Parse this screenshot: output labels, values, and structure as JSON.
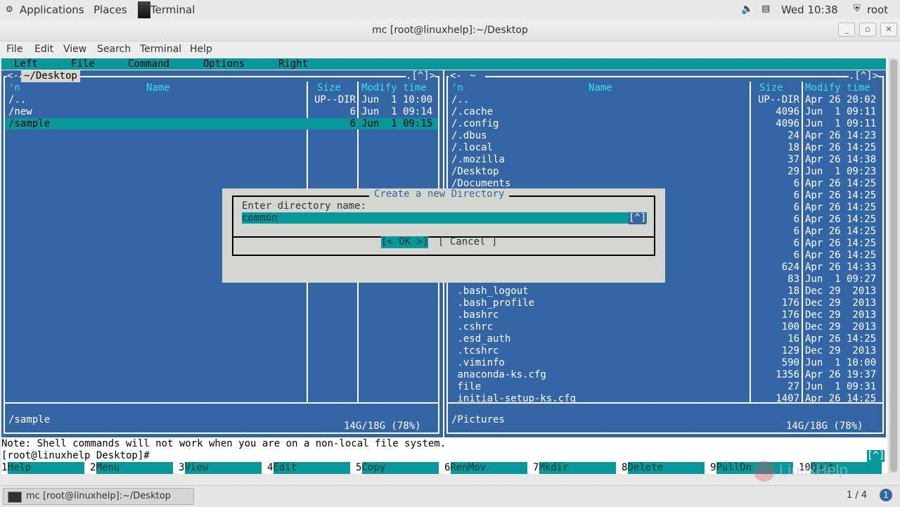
{
  "topbar": {
    "applications": "Applications",
    "places": "Places",
    "terminal": "Terminal",
    "volume_icon": "speaker-icon",
    "clock": "Wed 10:38",
    "user": "root"
  },
  "window": {
    "title": "mc [root@linuxhelp]:~/Desktop"
  },
  "menubar": {
    "items": [
      "File",
      "Edit",
      "View",
      "Search",
      "Terminal",
      "Help"
    ]
  },
  "mc": {
    "menu": [
      "Left",
      "File",
      "Command",
      "Options",
      "Right"
    ],
    "left": {
      "path": "~/Desktop",
      "corner": ".[^]>",
      "head": {
        "name": "Name",
        "size": "Size",
        "mtime": "Modify time",
        "sort": "'n"
      },
      "rows": [
        {
          "name": "/..",
          "size": "UP--DIR",
          "mtime": "Jun  1 10:00"
        },
        {
          "name": "/new",
          "size": "6",
          "mtime": "Jun  1 09:14"
        },
        {
          "name": "/sample",
          "size": "6",
          "mtime": "Jun  1 09:15"
        }
      ],
      "status": "/sample",
      "free": "14G/18G (78%)"
    },
    "right": {
      "path": "~",
      "corner": ".[^]>",
      "head": {
        "name": "Name",
        "size": "Size",
        "mtime": "Modify time",
        "sort": "'n"
      },
      "rows": [
        {
          "name": "/..",
          "size": "UP--DIR",
          "mtime": "Apr 26 20:02"
        },
        {
          "name": "/.cache",
          "size": "4096",
          "mtime": "Jun  1 09:11"
        },
        {
          "name": "/.config",
          "size": "4096",
          "mtime": "Jun  1 09:11"
        },
        {
          "name": "/.dbus",
          "size": "24",
          "mtime": "Apr 26 14:23"
        },
        {
          "name": "/.local",
          "size": "18",
          "mtime": "Apr 26 14:25"
        },
        {
          "name": "/.mozilla",
          "size": "37",
          "mtime": "Apr 26 14:38"
        },
        {
          "name": "/Desktop",
          "size": "29",
          "mtime": "Jun  1 09:23"
        },
        {
          "name": "/Documents",
          "size": "6",
          "mtime": "Apr 26 14:25"
        },
        {
          "name": "",
          "size": "6",
          "mtime": "Apr 26 14:25"
        },
        {
          "name": "",
          "size": "6",
          "mtime": "Apr 26 14:25"
        },
        {
          "name": "",
          "size": "6",
          "mtime": "Apr 26 14:25"
        },
        {
          "name": "",
          "size": "6",
          "mtime": "Apr 26 14:25"
        },
        {
          "name": "",
          "size": "6",
          "mtime": "Apr 26 14:25"
        },
        {
          "name": "",
          "size": "6",
          "mtime": "Apr 26 14:25"
        },
        {
          "name": "",
          "size": "624",
          "mtime": "Apr 26 14:33"
        },
        {
          "name": "",
          "size": "83",
          "mtime": "Jun  1 09:27"
        },
        {
          "name": " .bash_logout",
          "size": "18",
          "mtime": "Dec 29  2013"
        },
        {
          "name": " .bash_profile",
          "size": "176",
          "mtime": "Dec 29  2013"
        },
        {
          "name": " .bashrc",
          "size": "176",
          "mtime": "Dec 29  2013"
        },
        {
          "name": " .cshrc",
          "size": "100",
          "mtime": "Dec 29  2013"
        },
        {
          "name": " .esd_auth",
          "size": "16",
          "mtime": "Apr 26 14:25"
        },
        {
          "name": " .tcshrc",
          "size": "129",
          "mtime": "Dec 29  2013"
        },
        {
          "name": " .viminfo",
          "size": "590",
          "mtime": "Jun  1 10:00"
        },
        {
          "name": " anaconda-ks.cfg",
          "size": "1356",
          "mtime": "Apr 26 19:37"
        },
        {
          "name": " file",
          "size": "27",
          "mtime": "Jun  1 09:31"
        },
        {
          "name": " initial-setup-ks.cfg",
          "size": "1407",
          "mtime": "Apr 26 14:25"
        }
      ],
      "status": "/Pictures",
      "free": "14G/18G (78%)"
    },
    "dialog": {
      "title": "Create a new Directory",
      "prompt": "Enter directory name:",
      "value": "common",
      "history": "[^]",
      "ok": "[< OK >]",
      "cancel": "[ Cancel ]"
    },
    "note": "Note: Shell commands will not work when you are on a non-local file system.",
    "prompt": "[root@linuxhelp Desktop]#",
    "prompt_corner": "[^]",
    "fkeys": [
      {
        "n": "1",
        "l": "Help"
      },
      {
        "n": "2",
        "l": "Menu"
      },
      {
        "n": "3",
        "l": "View"
      },
      {
        "n": "4",
        "l": "Edit"
      },
      {
        "n": "5",
        "l": "Copy"
      },
      {
        "n": "6",
        "l": "RenMov"
      },
      {
        "n": "7",
        "l": "Mkdir"
      },
      {
        "n": "8",
        "l": "Delete"
      },
      {
        "n": "9",
        "l": "PullDn"
      },
      {
        "n": "10",
        "l": "Quit"
      }
    ]
  },
  "watermark": "LinuxHelp",
  "taskbar": {
    "task": "mc [root@linuxhelp]:~/Desktop",
    "pager": "1 / 4"
  }
}
